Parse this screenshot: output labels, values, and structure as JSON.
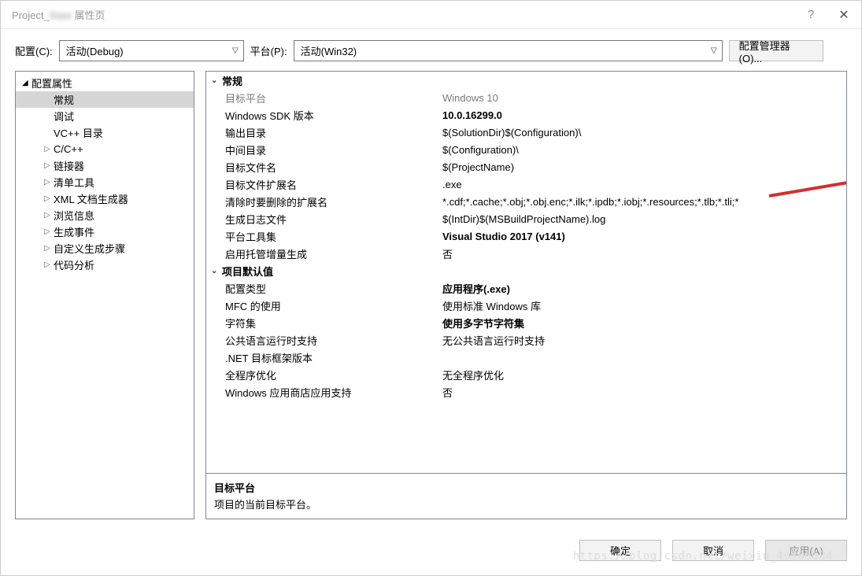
{
  "titlebar": {
    "prefix": "Project_",
    "blur": "Xxxx",
    "suffix": " 属性页"
  },
  "toolbar": {
    "config_label": "配置(C):",
    "config_value": "活动(Debug)",
    "platform_label": "平台(P):",
    "platform_value": "活动(Win32)",
    "manager_btn": "配置管理器(O)..."
  },
  "tree": {
    "root": "配置属性",
    "items": [
      {
        "label": "常规",
        "selected": true
      },
      {
        "label": "调试"
      },
      {
        "label": "VC++ 目录"
      },
      {
        "label": "C/C++",
        "expandable": true
      },
      {
        "label": "链接器",
        "expandable": true
      },
      {
        "label": "清单工具",
        "expandable": true
      },
      {
        "label": "XML 文档生成器",
        "expandable": true
      },
      {
        "label": "浏览信息",
        "expandable": true
      },
      {
        "label": "生成事件",
        "expandable": true
      },
      {
        "label": "自定义生成步骤",
        "expandable": true
      },
      {
        "label": "代码分析",
        "expandable": true
      }
    ]
  },
  "grid": {
    "sections": [
      {
        "title": "常规",
        "rows": [
          {
            "name": "目标平台",
            "value": "Windows 10",
            "name_gray": true,
            "value_gray": true
          },
          {
            "name": "Windows SDK 版本",
            "value": "10.0.16299.0",
            "bold": true
          },
          {
            "name": "输出目录",
            "value": "$(SolutionDir)$(Configuration)\\"
          },
          {
            "name": "中间目录",
            "value": "$(Configuration)\\"
          },
          {
            "name": "目标文件名",
            "value": "$(ProjectName)"
          },
          {
            "name": "目标文件扩展名",
            "value": ".exe"
          },
          {
            "name": "清除时要删除的扩展名",
            "value": "*.cdf;*.cache;*.obj;*.obj.enc;*.ilk;*.ipdb;*.iobj;*.resources;*.tlb;*.tli;*"
          },
          {
            "name": "生成日志文件",
            "value": "$(IntDir)$(MSBuildProjectName).log"
          },
          {
            "name": "平台工具集",
            "value": "Visual Studio 2017 (v141)",
            "bold": true
          },
          {
            "name": "启用托管增量生成",
            "value": "否"
          }
        ]
      },
      {
        "title": "项目默认值",
        "rows": [
          {
            "name": "配置类型",
            "value": "应用程序(.exe)",
            "bold": true
          },
          {
            "name": "MFC 的使用",
            "value": "使用标准 Windows 库"
          },
          {
            "name": "字符集",
            "value": "使用多字节字符集",
            "bold": true
          },
          {
            "name": "公共语言运行时支持",
            "value": "无公共语言运行时支持"
          },
          {
            "name": ".NET 目标框架版本",
            "value": ""
          },
          {
            "name": "全程序优化",
            "value": "无全程序优化"
          },
          {
            "name": "Windows 应用商店应用支持",
            "value": "否"
          }
        ]
      }
    ]
  },
  "desc": {
    "title": "目标平台",
    "text": "项目的当前目标平台。"
  },
  "footer": {
    "ok": "确定",
    "cancel": "取消",
    "apply": "应用(A)"
  },
  "watermark": "https://blog.csdn.net/weixin_40866684"
}
